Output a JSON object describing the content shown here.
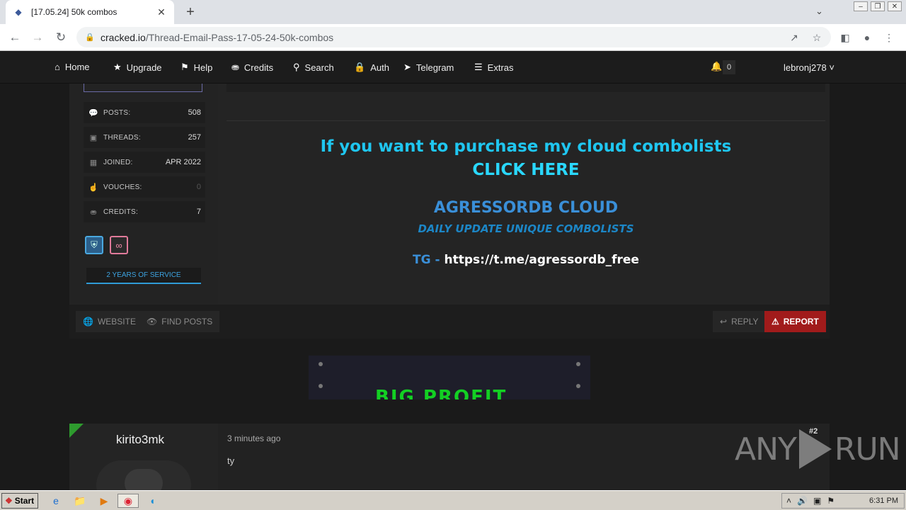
{
  "browser": {
    "tab_title": "[17.05.24] 50k combos",
    "url_domain": "cracked.io",
    "url_path": "/Thread-Email-Pass-17-05-24-50k-combos"
  },
  "nav": {
    "items": [
      {
        "label": "Home",
        "icon": "home-icon"
      },
      {
        "label": "Upgrade",
        "icon": "star-icon"
      },
      {
        "label": "Help",
        "icon": "flag-icon"
      },
      {
        "label": "Credits",
        "icon": "coins-icon"
      },
      {
        "label": "Search",
        "icon": "search-icon"
      },
      {
        "label": "Auth",
        "icon": "lock-icon"
      },
      {
        "label": "Telegram",
        "icon": "telegram-icon"
      },
      {
        "label": "Extras",
        "icon": "menu-icon"
      }
    ],
    "notification_count": "0",
    "username": "lebronj278"
  },
  "author": {
    "stats": [
      {
        "label": "POSTS:",
        "value": "508"
      },
      {
        "label": "THREADS:",
        "value": "257"
      },
      {
        "label": "JOINED:",
        "value": "APR 2022"
      },
      {
        "label": "VOUCHES:",
        "value": "0"
      },
      {
        "label": "CREDITS:",
        "value": "7"
      }
    ],
    "service_badge": "2 YEARS OF SERVICE"
  },
  "post": {
    "promo_line1": "If you want to purchase my cloud combolists",
    "promo_line2": "CLICK HERE",
    "brand": "AGRESSORDB CLOUD",
    "tagline": "DAILY UPDATE UNIQUE COMBOLISTS",
    "tg_label": "TG - ",
    "tg_link": "https://t.me/agressordb_free"
  },
  "post_actions": {
    "website": "WEBSITE",
    "find_posts": "FIND POSTS",
    "reply": "REPLY",
    "report": "REPORT"
  },
  "ad": {
    "text": "BIG PROFIT"
  },
  "reply_post": {
    "username": "kirito3mk",
    "time": "3 minutes ago",
    "message": "ty",
    "number": "#2"
  },
  "watermark": {
    "left": "ANY",
    "right": "RUN"
  },
  "taskbar": {
    "start": "Start",
    "clock": "6:31 PM"
  },
  "colors": {
    "accent_cyan": "#1fc6f0",
    "brand_blue": "#3a8fd8",
    "report_red": "#a11b1b",
    "service_blue": "#2f9bd6"
  }
}
